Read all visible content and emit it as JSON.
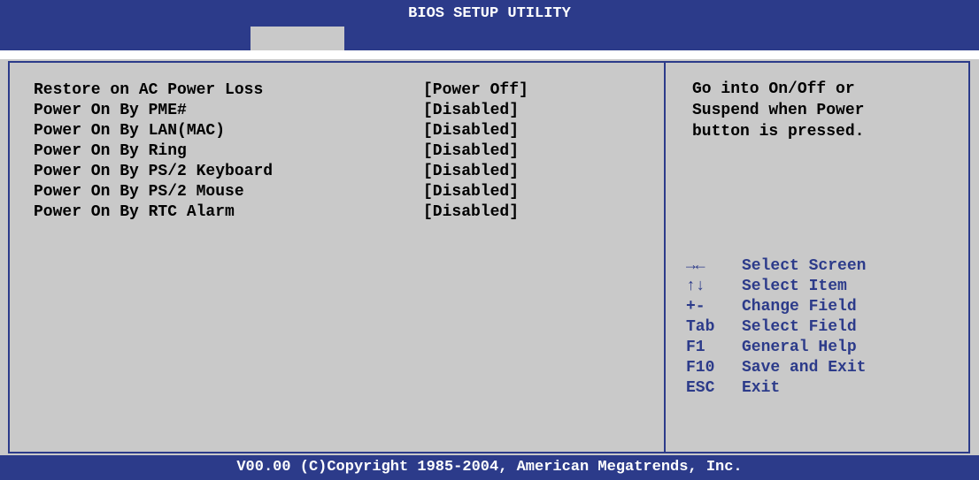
{
  "header": {
    "title": "BIOS SETUP UTILITY"
  },
  "settings": [
    {
      "label": "Restore on AC Power Loss",
      "value": "[Power Off]"
    },
    {
      "label": "Power On By PME#",
      "value": "[Disabled]"
    },
    {
      "label": "Power On By LAN(MAC)",
      "value": "[Disabled]"
    },
    {
      "label": "Power On By Ring",
      "value": "[Disabled]"
    },
    {
      "label": "Power On By PS/2 Keyboard",
      "value": "[Disabled]"
    },
    {
      "label": "Power On By PS/2 Mouse",
      "value": "[Disabled]"
    },
    {
      "label": "Power On By RTC Alarm",
      "value": "[Disabled]"
    }
  ],
  "help": {
    "lines": [
      "Go into On/Off or",
      "Suspend when Power",
      "button is pressed."
    ]
  },
  "keys": [
    {
      "key": "→←",
      "desc": "Select Screen"
    },
    {
      "key": "↑↓",
      "desc": "Select Item"
    },
    {
      "key": "+-",
      "desc": "Change Field"
    },
    {
      "key": "Tab",
      "desc": "Select Field"
    },
    {
      "key": "F1",
      "desc": "General Help"
    },
    {
      "key": "F10",
      "desc": "Save and Exit"
    },
    {
      "key": "ESC",
      "desc": "Exit"
    }
  ],
  "footer": {
    "copyright": "V00.00 (C)Copyright 1985-2004, American Megatrends, Inc."
  },
  "colors": {
    "header_bg": "#2c3b8a",
    "panel_bg": "#c9c9c9",
    "text": "#000000",
    "key_text": "#2c3b8a"
  }
}
